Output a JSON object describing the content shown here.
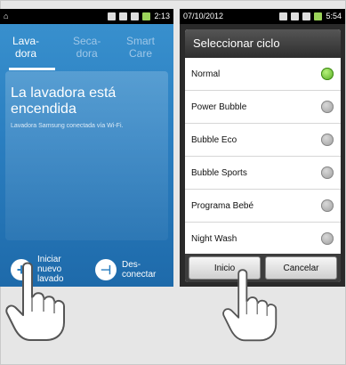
{
  "left_screen": {
    "status_time": "2:13",
    "tabs": [
      {
        "line1": "Lava-",
        "line2": "dora"
      },
      {
        "line1": "Seca-",
        "line2": "dora"
      },
      {
        "line1": "Smart",
        "line2": "Care"
      }
    ],
    "title_line1": "La lavadora está",
    "title_line2": "encendida",
    "subtitle": "Lavadora Samsung conectada vía Wi-Fi.",
    "actions": {
      "start": {
        "line1": "Iniciar",
        "line2": "nuevo",
        "line3": "lavado"
      },
      "disconnect": {
        "line1": "Des-",
        "line2": "conectar"
      }
    }
  },
  "right_screen": {
    "status_date": "07/10/2012",
    "status_time": "5:54",
    "dialog_title": "Seleccionar ciclo",
    "options": [
      {
        "label": "Normal",
        "selected": true
      },
      {
        "label": "Power Bubble",
        "selected": false
      },
      {
        "label": "Bubble Eco",
        "selected": false
      },
      {
        "label": "Bubble Sports",
        "selected": false
      },
      {
        "label": "Programa Bebé",
        "selected": false
      },
      {
        "label": "Night Wash",
        "selected": false
      }
    ],
    "buttons": {
      "start": "Inicio",
      "cancel": "Cancelar"
    }
  },
  "colors": {
    "accent_blue": "#2b7fc1",
    "selected_green": "#4fa61c"
  }
}
